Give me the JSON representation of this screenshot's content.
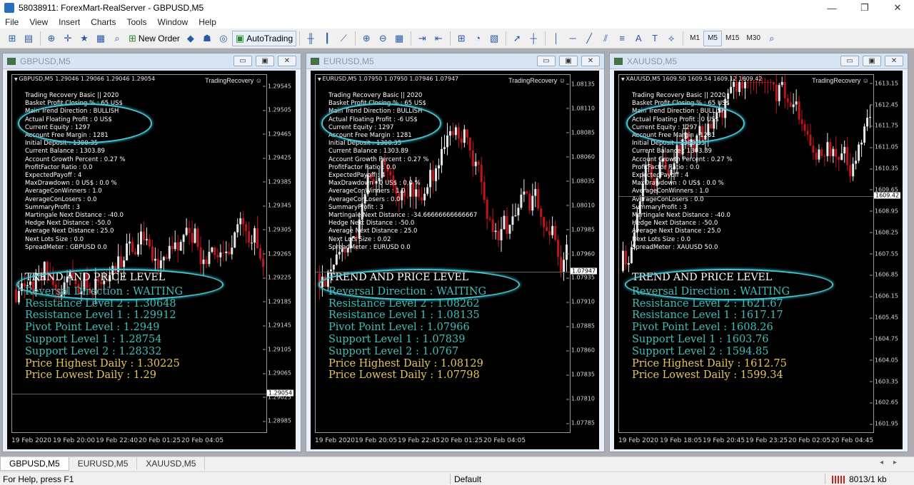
{
  "app": {
    "title": "58038911: ForexMart-RealServer - GBPUSD,M5"
  },
  "window_controls": {
    "minimize": "—",
    "restore": "❐",
    "close": "✕"
  },
  "menu": [
    "File",
    "View",
    "Insert",
    "Charts",
    "Tools",
    "Window",
    "Help"
  ],
  "toolbar": {
    "new_order": "New Order",
    "autotrading": "AutoTrading",
    "timeframes": [
      "M1",
      "M5",
      "M15",
      "M30"
    ],
    "active_timeframe": "M5"
  },
  "charts": [
    {
      "window_title": "GBPUSD,M5",
      "symbol_line": "GBPUSD,M5  1.29046 1.29066 1.29046 1.29054",
      "indicator_name": "TradingRecovery ☺",
      "price_ticks": [
        "1.29545",
        "1.29505",
        "1.29465",
        "1.29425",
        "1.29385",
        "1.29345",
        "1.29305",
        "1.29265",
        "1.29225",
        "1.29185",
        "1.29145",
        "1.29105",
        "1.29065",
        "1.29025",
        "1.28985"
      ],
      "current_price": "1.29054",
      "time_labels": [
        "19 Feb 2020",
        "19 Feb 20:00",
        "19 Feb 22:40",
        "20 Feb 01:25",
        "20 Feb 04:05"
      ],
      "info": [
        "Trading Recovery Basic || 2020",
        "Basket Profit Closing %    :  65 US$",
        "Main Trend Direction     :  BULLISH",
        "Actual Floating Profit    :  0 US$",
        "Current Equity    :  1297",
        "Account Free Margin   :  1281",
        "Initial Deposit     :  1300.35",
        "Current Balance     :  1303.89",
        "Account Growth Percent    :  0.27 %",
        "ProfitFactor Ratio   :  0.0",
        "ExpectedPayoff    :  4",
        "MaxDrawdown   :  0 US$  :  0.0 %",
        "AverageConWinners    :  1.0",
        "AverageConLosers    :  0.0",
        "SummaryProfit    :  3",
        "Martingale Next Distance    :  -40.0",
        "Hedge Next Distance    :  -50.0",
        "Average Next Distance    :  25.0",
        "Next Lots Size    :  0.0",
        "SpreadMeter    :  GBPUSD  0.0"
      ],
      "trend_header": "TREND AND PRICE LEVEL",
      "levels": [
        "Reversal Direction   :  WAITING",
        "Resistance Level 2 : 1.30648",
        "Resistance Level 1 : 1.29912",
        "Pivot Point Level : 1.2949",
        "Support Level 1 : 1.28754",
        "Support Level 2 : 1.28332",
        "Price Highest Daily : 1.30225",
        "Price Lowest Daily : 1.29"
      ]
    },
    {
      "window_title": "EURUSD,M5",
      "symbol_line": "EURUSD,M5  1.07950 1.07950 1.07946 1.07947",
      "indicator_name": "TradingRecovery ☺",
      "price_ticks": [
        "1.08135",
        "1.08110",
        "1.08085",
        "1.08060",
        "1.08035",
        "1.08010",
        "1.07985",
        "1.07960",
        "1.07935",
        "1.07910",
        "1.07885",
        "1.07860",
        "1.07835",
        "1.07810",
        "1.07785"
      ],
      "current_price": "1.07947",
      "time_labels": [
        "19 Feb 2020",
        "19 Feb 20:05",
        "19 Feb 22:45",
        "20 Feb 01:25",
        "20 Feb 04:05"
      ],
      "info": [
        "Trading Recovery Basic || 2020",
        "Basket Profit Closing %    :  65 US$",
        "Main Trend Direction     :  BULLISH",
        "Actual Floating Profit    :  -6 US$",
        "Current Equity    :  1297",
        "Account Free Margin   :  1281",
        "Initial Deposit     :  1300.35",
        "Current Balance     :  1303.89",
        "Account Growth Percent    :  0.27 %",
        "ProfitFactor Ratio   :  0.0",
        "ExpectedPayoff    :  4",
        "MaxDrawdown   :  0 US$  :  0.0 %",
        "AverageConWinners    :  1.0",
        "AverageConLosers    :  0.0",
        "SummaryProfit    :  3",
        "Martingale Next Distance    :  -34.66666666666667",
        "Hedge Next Distance    :  -50.0",
        "Average Next Distance    :  25.0",
        "Next Lots Size    :  0.02",
        "SpreadMeter    :  EURUSD  0.0"
      ],
      "trend_header": "TREND AND PRICE LEVEL",
      "levels": [
        "Reversal Direction   :  WAITING",
        "Resistance Level 2 : 1.08262",
        "Resistance Level 1 : 1.08135",
        "Pivot Point Level : 1.07966",
        "Support Level 1 : 1.07839",
        "Support Level 2 : 1.0767",
        "Price Highest Daily : 1.08129",
        "Price Lowest Daily : 1.07798"
      ]
    },
    {
      "window_title": "XAUUSD,M5",
      "symbol_line": "XAUUSD,M5  1609.50 1609.54 1609.12 1609.42",
      "indicator_name": "TradingRecovery ☺",
      "price_ticks": [
        "1613.15",
        "1612.45",
        "1611.75",
        "1611.05",
        "1610.35",
        "1609.65",
        "1608.95",
        "1608.25",
        "1607.55",
        "1606.85",
        "1606.15",
        "1605.45",
        "1604.75",
        "1604.05",
        "1603.35",
        "1602.65",
        "1601.95"
      ],
      "current_price": "1609.42",
      "time_labels": [
        "19 Feb 2020",
        "19 Feb 18:05",
        "19 Feb 20:45",
        "19 Feb 23:25",
        "20 Feb 02:05",
        "20 Feb 04:45"
      ],
      "info": [
        "Trading Recovery Basic || 2020",
        "Basket Profit Closing %    :  65 US$",
        "Main Trend Direction     :  BULLISH",
        "Actual Floating Profit    :  0 US$",
        "Current Equity    :  1297",
        "Account Free Margin   :  1281",
        "Initial Deposit     :  1300.35",
        "Current Balance     :  1303.89",
        "Account Growth Percent    :  0.27 %",
        "ProfitFactor Ratio   :  0.0",
        "ExpectedPayoff    :  4",
        "MaxDrawdown   :  0 US$  :  0.0 %",
        "AverageConWinners    :  1.0",
        "AverageConLosers    :  0.0",
        "SummaryProfit    :  3",
        "Martingale Next Distance    :  -40.0",
        "Hedge Next Distance    :  -50.0",
        "Average Next Distance    :  25.0",
        "Next Lots Size    :  0.0",
        "SpreadMeter    :  XAUUSD  50.0"
      ],
      "trend_header": "TREND AND PRICE LEVEL",
      "levels": [
        "Reversal Direction   :  WAITING",
        "Resistance Level 2 : 1621.67",
        "Resistance Level 1 : 1617.17",
        "Pivot Point Level : 1608.26",
        "Support Level 1 : 1603.76",
        "Support Level 2 : 1594.85",
        "Price Highest Daily : 1612.75",
        "Price Lowest Daily : 1599.34"
      ]
    }
  ],
  "tabs": [
    "GBPUSD,M5",
    "EURUSD,M5",
    "XAUUSD,M5"
  ],
  "active_tab": "GBPUSD,M5",
  "status": {
    "help": "For Help, press F1",
    "profile": "Default",
    "traffic": "8013/1 kb"
  },
  "colors": {
    "level_cyan": "#3dbfb7",
    "level_yellow": "#e4c65c",
    "ellipse": "#47c6d6",
    "bull": "#e8e8e8",
    "bear": "#c0171e"
  }
}
